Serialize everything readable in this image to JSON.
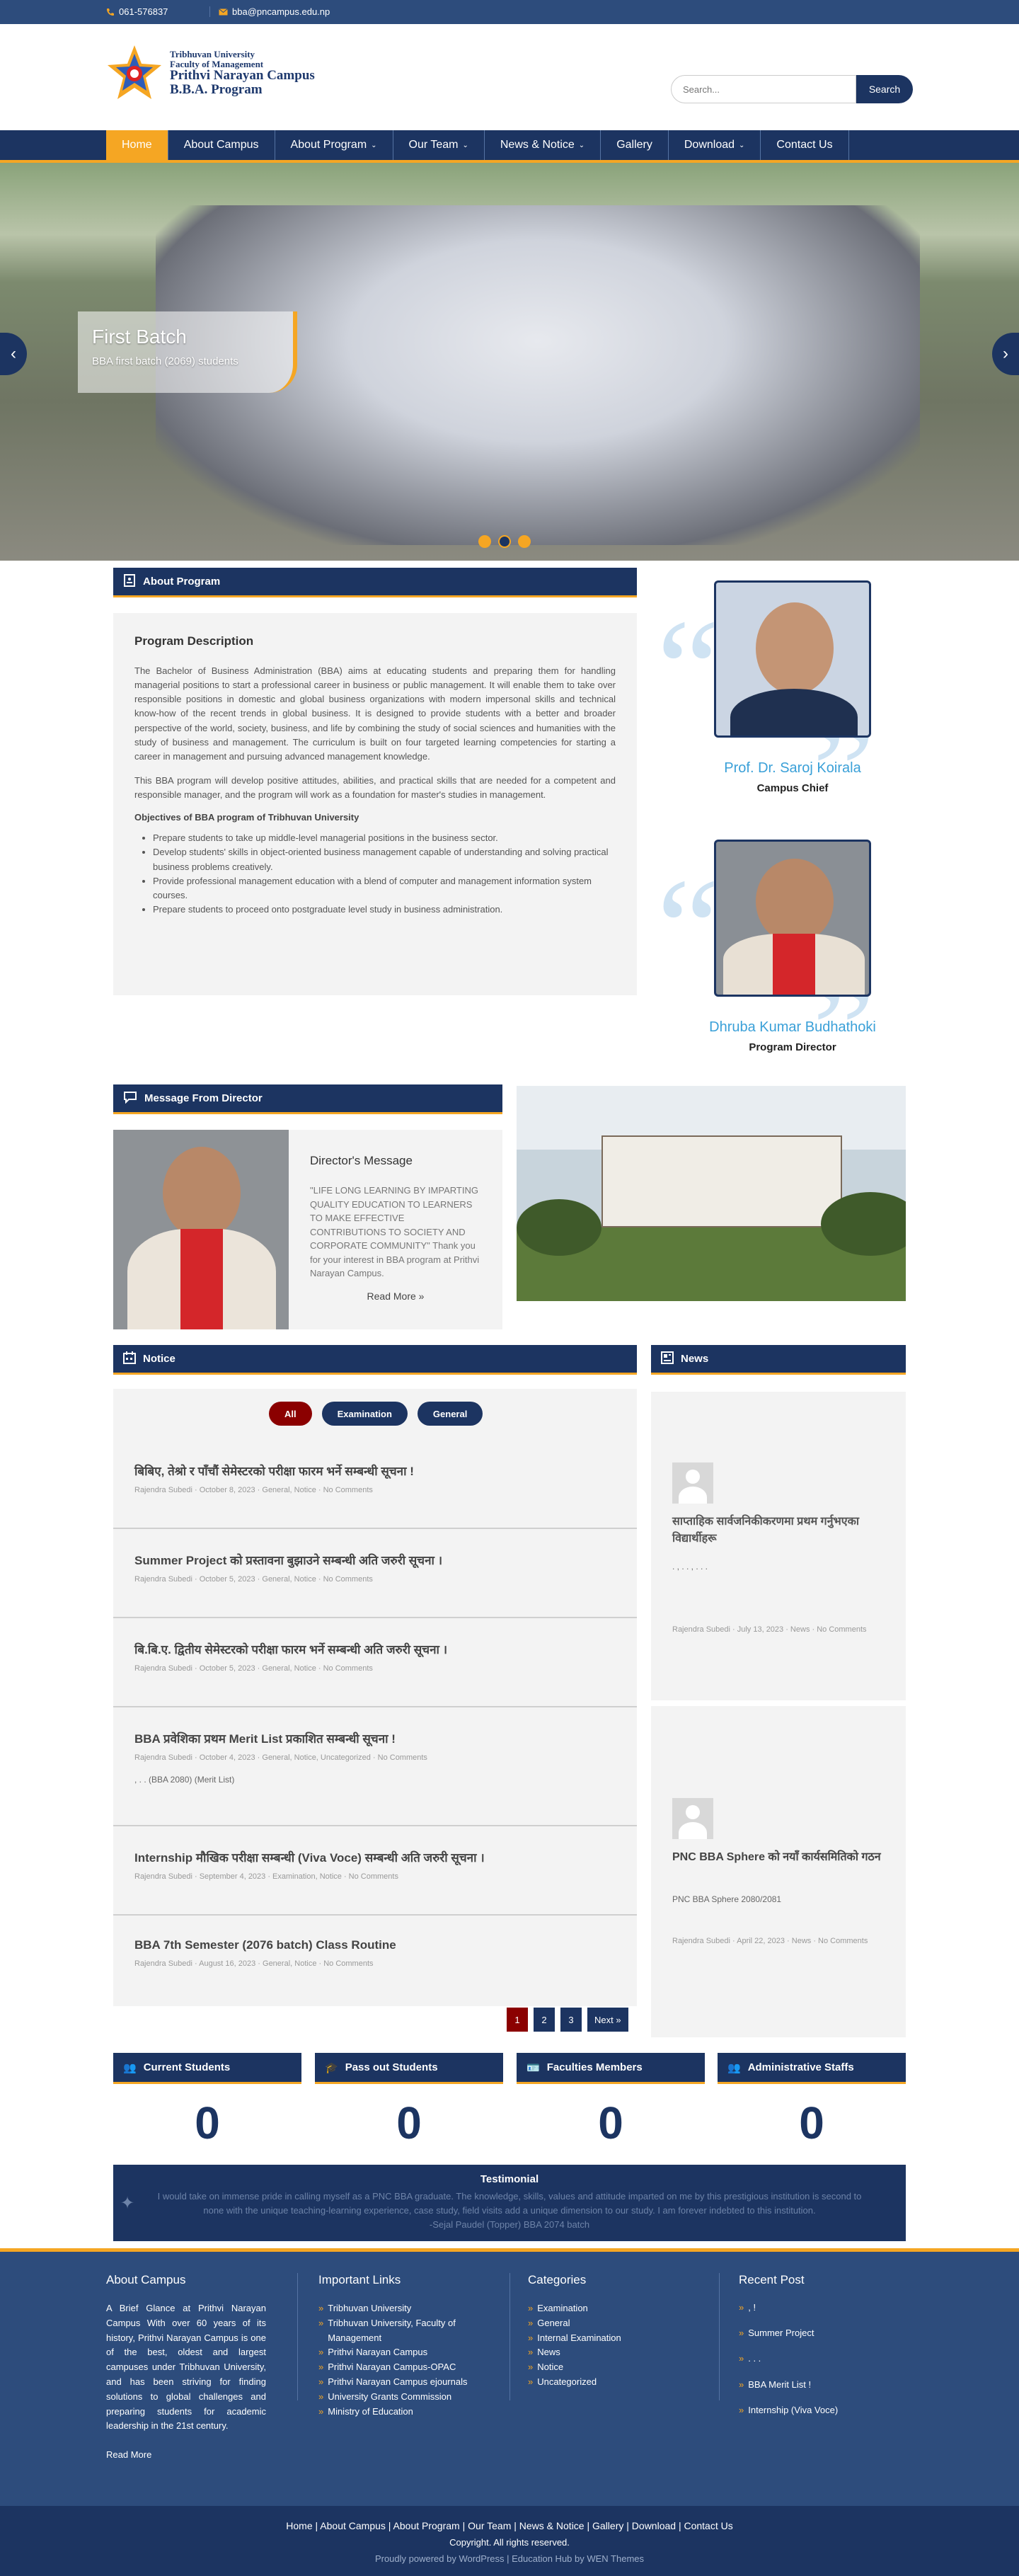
{
  "topbar": {
    "phone": "061-576837",
    "email": "bba@pncampus.edu.np"
  },
  "logo": {
    "line1": "Tribhuvan University",
    "line2": "Faculty of Management",
    "line3": "Prithvi Narayan Campus",
    "line4": "B.B.A. Program"
  },
  "search": {
    "placeholder": "Search...",
    "button": "Search"
  },
  "nav": [
    "Home",
    "About Campus",
    "About Program",
    "Our Team",
    "News & Notice",
    "Gallery",
    "Download",
    "Contact Us"
  ],
  "slider": {
    "title": "First Batch",
    "subtitle": "BBA first batch (2069) students"
  },
  "about": {
    "bar": "About Program",
    "heading": "Program Description",
    "p1": "The Bachelor of Business Administration (BBA) aims at educating students and preparing them for handling managerial positions to start a professional career in business or public management. It will enable them to take over responsible positions in domestic and global business organizations with modern impersonal skills and technical know-how of the recent trends in global business. It is designed to provide students with a better and broader perspective of the world, society, business, and life by combining the study of social sciences and humanities with the study of business and management. The curriculum is built on four targeted learning competencies for starting a career in management and pursuing advanced management knowledge.",
    "p2": "This BBA program will develop positive attitudes, abilities, and practical skills that are needed for a competent and responsible manager, and the program will work as a foundation for master's studies in management.",
    "obj_heading": "Objectives of BBA program of Tribhuvan University",
    "objectives": [
      "Prepare students to take up middle-level managerial positions in the business sector.",
      "Develop students' skills in object-oriented business management capable of understanding and solving practical business problems creatively.",
      "Provide professional management education with a blend of computer and management information system courses.",
      "Prepare students to proceed onto postgraduate level study in business administration."
    ]
  },
  "people": [
    {
      "name": "Prof. Dr. Saroj Koirala",
      "role": "Campus Chief"
    },
    {
      "name": "Dhruba Kumar Budhathoki",
      "role": "Program Director"
    }
  ],
  "director": {
    "bar": "Message From Director",
    "title": "Director's Message",
    "text": "\"LIFE LONG LEARNING BY IMPARTING QUALITY EDUCATION TO LEARNERS TO MAKE EFFECTIVE CONTRIBUTIONS TO SOCIETY AND CORPORATE COMMUNITY\" Thank you for your interest in BBA program at Prithvi Narayan Campus.",
    "read_more": "Read More »"
  },
  "notice": {
    "bar": "Notice",
    "filters": [
      "All",
      "Examination",
      "General"
    ],
    "items": [
      {
        "title": "बिबिए, तेश्रो र पाँचौं सेमेस्टरको परीक्षा फारम भर्ने सम्बन्धी सूचना !",
        "meta": "Rajendra Subedi · October 8, 2023 · General, Notice · No Comments",
        "excerpt": ""
      },
      {
        "title": "Summer Project को प्रस्तावना बुझाउने सम्बन्धी अति जरुरी सूचना ।",
        "meta": "Rajendra Subedi · October 5, 2023 · General, Notice · No Comments",
        "excerpt": ""
      },
      {
        "title": "बि.बि.ए. द्वितीय सेमेस्टरको परीक्षा फारम भर्ने सम्बन्धी अति जरुरी सूचना ।",
        "meta": "Rajendra Subedi · October 5, 2023 · General, Notice · No Comments",
        "excerpt": ""
      },
      {
        "title": "BBA प्रवेशिका प्रथम Merit List प्रकाशित सम्बन्धी सूचना !",
        "meta": "Rajendra Subedi · October 4, 2023 · General, Notice, Uncategorized · No Comments",
        "excerpt": ", . . (BBA 2080) (Merit List)"
      },
      {
        "title": "Internship मौखिक परीक्षा सम्बन्धी (Viva Voce) सम्बन्धी अति जरुरी सूचना ।",
        "meta": "Rajendra Subedi · September 4, 2023 · Examination, Notice · No Comments",
        "excerpt": ""
      },
      {
        "title": "BBA 7th Semester (2076 batch) Class Routine",
        "meta": "Rajendra Subedi · August 16, 2023 · General, Notice · No Comments",
        "excerpt": ""
      }
    ],
    "pages": [
      "1",
      "2",
      "3",
      "Next »"
    ]
  },
  "news": {
    "bar": "News",
    "items": [
      {
        "title": "साप्ताहिक सार्वजनिकीकरणमा प्रथम गर्नुभएका विद्यार्थीहरू",
        "excerpt": ". , . . , . . .",
        "meta": "Rajendra Subedi · July 13, 2023 · News · No Comments"
      },
      {
        "title": "PNC BBA Sphere को नयाँ कार्यसमितिको गठन",
        "excerpt": "PNC BBA Sphere 2080/2081",
        "meta": "Rajendra Subedi · April 22, 2023 · News · No Comments"
      }
    ]
  },
  "stats": [
    {
      "label": "Current Students",
      "value": "0"
    },
    {
      "label": "Pass out Students",
      "value": "0"
    },
    {
      "label": "Faculties Members",
      "value": "0"
    },
    {
      "label": "Administrative Staffs",
      "value": "0"
    }
  ],
  "testimonial": {
    "title": "Testimonial",
    "quote": "I would take on immense pride in calling myself as a PNC BBA graduate. The knowledge, skills, values and attitude imparted on me by this prestigious institution is second to none with the unique teaching-learning experience, case study, field visits add a unique dimension to our study. I am forever indebted to this institution.",
    "author": "-Sejal Paudel (Topper) BBA 2074 batch"
  },
  "footer": {
    "about_title": "About Campus",
    "about_text": "A Brief Glance at Prithvi Narayan Campus With over 60 years of its history, Prithvi Narayan Campus is one of the best, oldest and largest campuses under Tribhuvan University, and has been striving for finding solutions to global challenges and preparing students for academic leadership in the 21st century.",
    "read_more": "Read More",
    "links_title": "Important Links",
    "links": [
      "Tribhuvan University",
      "Tribhuvan University, Faculty of Management",
      "Prithvi Narayan Campus",
      "Prithvi Narayan Campus-OPAC",
      "Prithvi Narayan Campus ejournals",
      "University Grants Commission",
      "Ministry of Education"
    ],
    "cat_title": "Categories",
    "categories": [
      "Examination",
      "General",
      "Internal Examination",
      "News",
      "Notice",
      "Uncategorized"
    ],
    "recent_title": "Recent Post",
    "recent": [
      ", !",
      "Summer Project",
      ". . .",
      "BBA Merit List !",
      "Internship (Viva Voce)"
    ]
  },
  "bottom": {
    "links": [
      "Home",
      "About Campus",
      "About Program",
      "Our Team",
      "News & Notice",
      "Gallery",
      "Download",
      "Contact Us"
    ],
    "copyright": "Copyright. All rights reserved.",
    "powered": "Proudly powered by WordPress | Education Hub by WEN Themes"
  },
  "colors": {
    "primary": "#1c3461",
    "accent": "#f5a623",
    "topbar": "#2d4c7c",
    "name": "#3aa0d8",
    "active_filter": "#8b0000"
  }
}
